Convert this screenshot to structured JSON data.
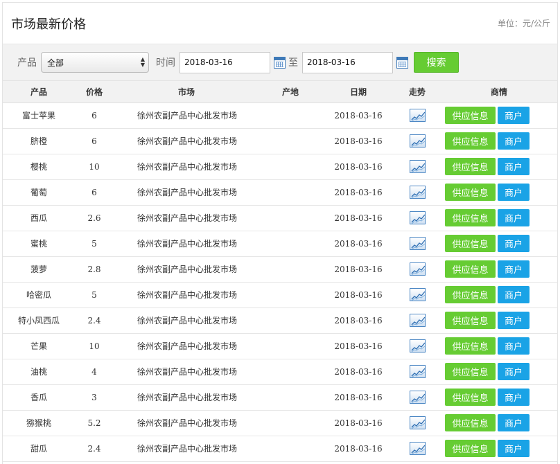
{
  "header": {
    "title": "市场最新价格",
    "unit": "单位：元/公斤"
  },
  "filter": {
    "product_label": "产品",
    "product_selected": "全部",
    "time_label": "时间",
    "date_from": "2018-03-16",
    "to_label": "至",
    "date_to": "2018-03-16",
    "search_label": "搜索"
  },
  "table": {
    "columns": [
      "产品",
      "价格",
      "市场",
      "产地",
      "日期",
      "走势",
      "商情"
    ],
    "supply_label": "供应信息",
    "merchant_label": "商户",
    "rows": [
      {
        "product": "富士苹果",
        "price": "6",
        "market": "徐州农副产品中心批发市场",
        "origin": "",
        "date": "2018-03-16"
      },
      {
        "product": "脐橙",
        "price": "6",
        "market": "徐州农副产品中心批发市场",
        "origin": "",
        "date": "2018-03-16"
      },
      {
        "product": "樱桃",
        "price": "10",
        "market": "徐州农副产品中心批发市场",
        "origin": "",
        "date": "2018-03-16"
      },
      {
        "product": "葡萄",
        "price": "6",
        "market": "徐州农副产品中心批发市场",
        "origin": "",
        "date": "2018-03-16"
      },
      {
        "product": "西瓜",
        "price": "2.6",
        "market": "徐州农副产品中心批发市场",
        "origin": "",
        "date": "2018-03-16"
      },
      {
        "product": "蜜桃",
        "price": "5",
        "market": "徐州农副产品中心批发市场",
        "origin": "",
        "date": "2018-03-16"
      },
      {
        "product": "菠萝",
        "price": "2.8",
        "market": "徐州农副产品中心批发市场",
        "origin": "",
        "date": "2018-03-16"
      },
      {
        "product": "哈密瓜",
        "price": "5",
        "market": "徐州农副产品中心批发市场",
        "origin": "",
        "date": "2018-03-16"
      },
      {
        "product": "特小凤西瓜",
        "price": "2.4",
        "market": "徐州农副产品中心批发市场",
        "origin": "",
        "date": "2018-03-16"
      },
      {
        "product": "芒果",
        "price": "10",
        "market": "徐州农副产品中心批发市场",
        "origin": "",
        "date": "2018-03-16"
      },
      {
        "product": "油桃",
        "price": "4",
        "market": "徐州农副产品中心批发市场",
        "origin": "",
        "date": "2018-03-16"
      },
      {
        "product": "香瓜",
        "price": "3",
        "market": "徐州农副产品中心批发市场",
        "origin": "",
        "date": "2018-03-16"
      },
      {
        "product": "猕猴桃",
        "price": "5.2",
        "market": "徐州农副产品中心批发市场",
        "origin": "",
        "date": "2018-03-16"
      },
      {
        "product": "甜瓜",
        "price": "2.4",
        "market": "徐州农副产品中心批发市场",
        "origin": "",
        "date": "2018-03-16"
      }
    ]
  },
  "icons": {
    "calendar": "calendar-icon",
    "trend": "trend-chart-icon"
  },
  "colors": {
    "green": "#66cc33",
    "blue": "#1aa3e6"
  }
}
